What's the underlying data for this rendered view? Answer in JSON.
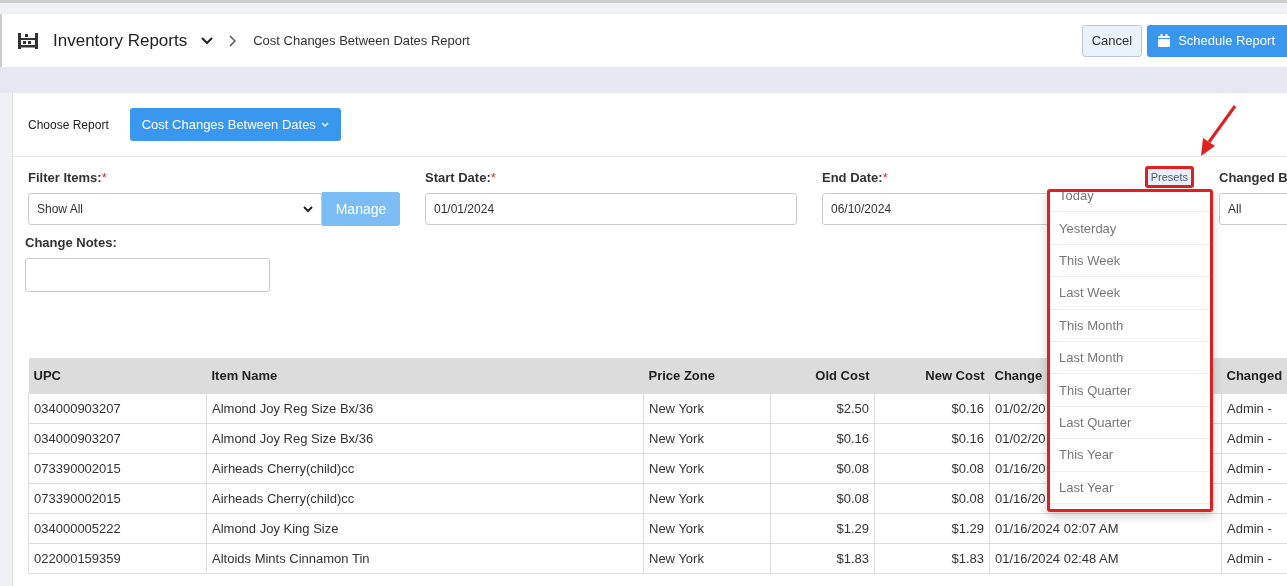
{
  "header": {
    "module": "Inventory Reports",
    "breadcrumb": "Cost Changes Between Dates Report",
    "buttons": [
      {
        "label": "Cancel",
        "kind": "secondary"
      },
      {
        "label": "Schedule Report",
        "kind": "primary"
      }
    ]
  },
  "report_picker": {
    "label": "Choose Report",
    "value": "Cost Changes Between Dates"
  },
  "filters": [
    {
      "kind": "select",
      "label": "Filter Items:",
      "required_mark": "*",
      "value": "Show All",
      "button": "Manage"
    },
    {
      "kind": "input",
      "label": "Start Date:",
      "required_mark": "*",
      "value": "01/01/2024"
    },
    {
      "kind": "input",
      "label": "End Date:",
      "required_mark": "*",
      "value": "06/10/2024",
      "presets": "Presets"
    },
    {
      "kind": "input",
      "label": "Changed B",
      "value": "All"
    }
  ],
  "change_notes": {
    "label": "Change Notes:"
  },
  "presets_menu": [
    "Today",
    "Yesterday",
    "This Week",
    "Last Week",
    "This Month",
    "Last Month",
    "This Quarter",
    "Last Quarter",
    "This Year",
    "Last Year"
  ],
  "table": {
    "columns": [
      {
        "label": "UPC",
        "kind": "text"
      },
      {
        "label": "Item Name",
        "kind": "text"
      },
      {
        "label": "Price Zone",
        "kind": "text"
      },
      {
        "label": "Old Cost",
        "kind": "amount"
      },
      {
        "label": "New Cost",
        "kind": "amount"
      },
      {
        "label": "Change",
        "kind": "text"
      },
      {
        "label": "Changed",
        "kind": "text"
      }
    ],
    "rows": [
      [
        "034000903207",
        "Almond Joy Reg Size Bx/36",
        "New York",
        "$2.50",
        "$0.16",
        "01/02/20",
        "Admin -"
      ],
      [
        "034000903207",
        "Almond Joy Reg Size Bx/36",
        "New York",
        "$0.16",
        "$0.16",
        "01/02/20",
        "Admin -"
      ],
      [
        "073390002015",
        "Airheads Cherry(child)cc",
        "New York",
        "$0.08",
        "$0.08",
        "01/16/20",
        "Admin -"
      ],
      [
        "073390002015",
        "Airheads Cherry(child)cc",
        "New York",
        "$0.08",
        "$0.08",
        "01/16/20",
        "Admin -"
      ],
      [
        "034000005222",
        "Almond Joy King Size",
        "New York",
        "$1.29",
        "$1.29",
        "01/16/2024 02:07 AM",
        "Admin -"
      ],
      [
        "022000159359",
        "Altoids Mints Cinnamon Tin",
        "New York",
        "$1.83",
        "$1.83",
        "01/16/2024 02:48 AM",
        "Admin -"
      ]
    ]
  }
}
